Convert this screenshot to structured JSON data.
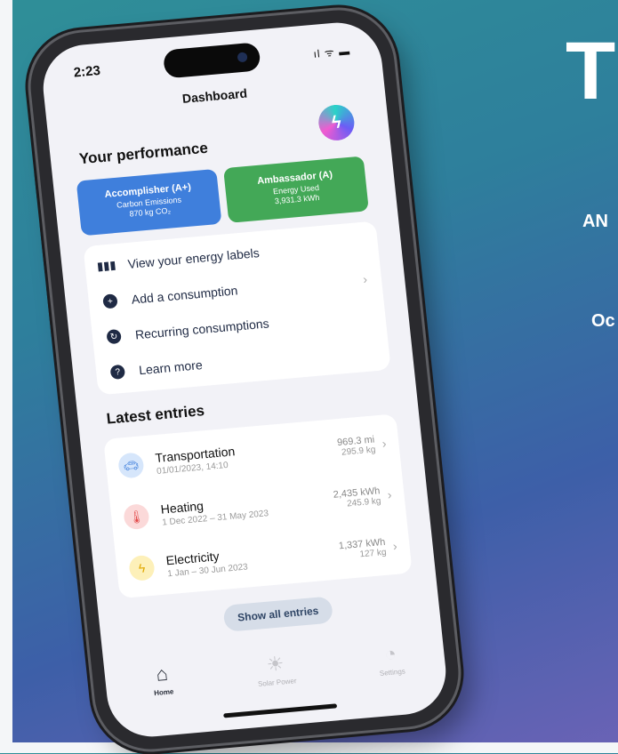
{
  "background": {
    "headline": "T",
    "line1": "AN",
    "line2": "Oc"
  },
  "status_bar": {
    "time": "2:23",
    "icons": "ıl ᯤ ▬"
  },
  "nav": {
    "title": "Dashboard"
  },
  "performance": {
    "title": "Your performance",
    "cards": [
      {
        "title": "Accomplisher (A+)",
        "subtitle": "Carbon Emissions",
        "value": "870 kg CO₂",
        "color": "#3f7fdc"
      },
      {
        "title": "Ambassador (A)",
        "subtitle": "Energy Used",
        "value": "3,931.3 kWh",
        "color": "#43a857"
      }
    ]
  },
  "menu": {
    "items": [
      {
        "label": "View your energy labels",
        "icon": "bar-chart-icon"
      },
      {
        "label": "Add a consumption",
        "icon": "plus-circle-icon"
      },
      {
        "label": "Recurring consumptions",
        "icon": "repeat-circle-icon"
      },
      {
        "label": "Learn more",
        "icon": "question-circle-icon"
      }
    ]
  },
  "entries": {
    "title": "Latest entries",
    "items": [
      {
        "name": "Transportation",
        "date": "01/01/2023, 14:10",
        "value1": "969.3 mi",
        "value2": "295.9 kg",
        "icon": "car-icon"
      },
      {
        "name": "Heating",
        "date": "1 Dec 2022 – 31 May 2023",
        "value1": "2,435 kWh",
        "value2": "245.9 kg",
        "icon": "thermometer-icon"
      },
      {
        "name": "Electricity",
        "date": "1 Jan – 30 Jun 2023",
        "value1": "1,337 kWh",
        "value2": "127 kg",
        "icon": "lightning-icon"
      }
    ],
    "show_all_label": "Show all entries"
  },
  "tabs": [
    {
      "label": "Home",
      "icon": "house-icon",
      "active": true
    },
    {
      "label": "Solar Power",
      "icon": "sun-icon",
      "active": false
    },
    {
      "label": "Settings",
      "icon": "gauge-icon",
      "active": false
    }
  ],
  "colors": {
    "accent_blue": "#3f7fdc",
    "accent_green": "#43a857",
    "navy": "#1f2a44"
  }
}
